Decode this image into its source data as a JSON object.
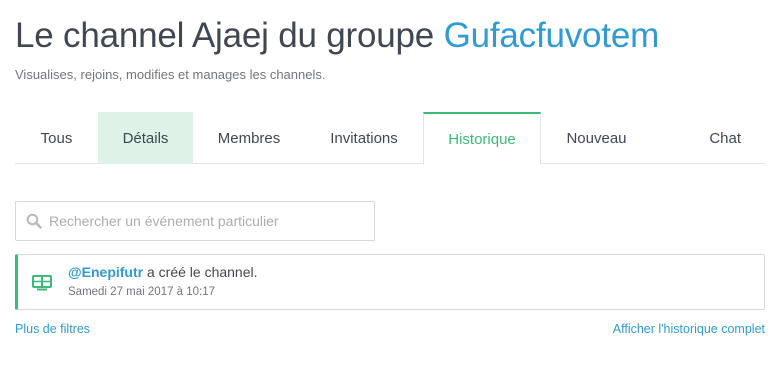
{
  "header": {
    "title_prefix": "Le channel Ajaej du groupe ",
    "group_name": "Gufacfuvotem",
    "subtitle": "Visualises, rejoins, modifies et manages les channels."
  },
  "tabs": [
    {
      "label": "Tous",
      "state": "normal"
    },
    {
      "label": "Détails",
      "state": "hover"
    },
    {
      "label": "Membres",
      "state": "normal"
    },
    {
      "label": "Invitations",
      "state": "normal"
    },
    {
      "label": "Historique",
      "state": "active"
    },
    {
      "label": "Nouveau",
      "state": "normal"
    },
    {
      "label": "Chat",
      "state": "normal"
    }
  ],
  "search": {
    "placeholder": "Rechercher un événement particulier",
    "value": ""
  },
  "events": [
    {
      "user": "@Enepifutr",
      "action": " a créé le channel.",
      "date": "Samedi 27 mai 2017 à 10:17",
      "icon": "channel-icon"
    }
  ],
  "footer": {
    "more_filters": "Plus de filtres",
    "full_history": "Afficher l'historique complet"
  },
  "colors": {
    "accent_green": "#3cba7a",
    "link_blue": "#2f9bd5",
    "hover_tab_bg": "#dff2e7"
  }
}
